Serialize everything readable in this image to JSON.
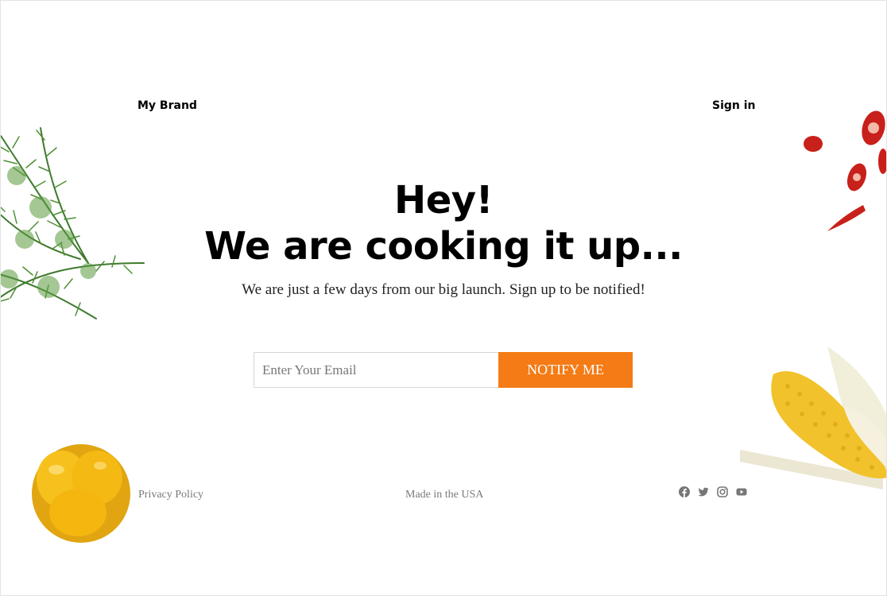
{
  "header": {
    "brand": "My Brand",
    "sign_in": "Sign in"
  },
  "hero": {
    "heading_line1": "Hey!",
    "heading_line2": "We are cooking it up...",
    "subtitle": "We are just a few days from our big launch. Sign up to be notified!"
  },
  "form": {
    "email_placeholder": "Enter Your Email",
    "email_value": "",
    "submit_label": "NOTIFY ME"
  },
  "footer": {
    "privacy": "Privacy Policy",
    "made_in": "Made in the USA",
    "social_icons": [
      "facebook-icon",
      "twitter-icon",
      "instagram-icon",
      "youtube-icon"
    ]
  },
  "decorations": [
    "dill-image",
    "chili-peppers-image",
    "corn-image",
    "yellow-pepper-image"
  ],
  "colors": {
    "accent": "#f47b16",
    "text": "#000000",
    "muted": "#7a7a7a",
    "icon": "#777777"
  }
}
